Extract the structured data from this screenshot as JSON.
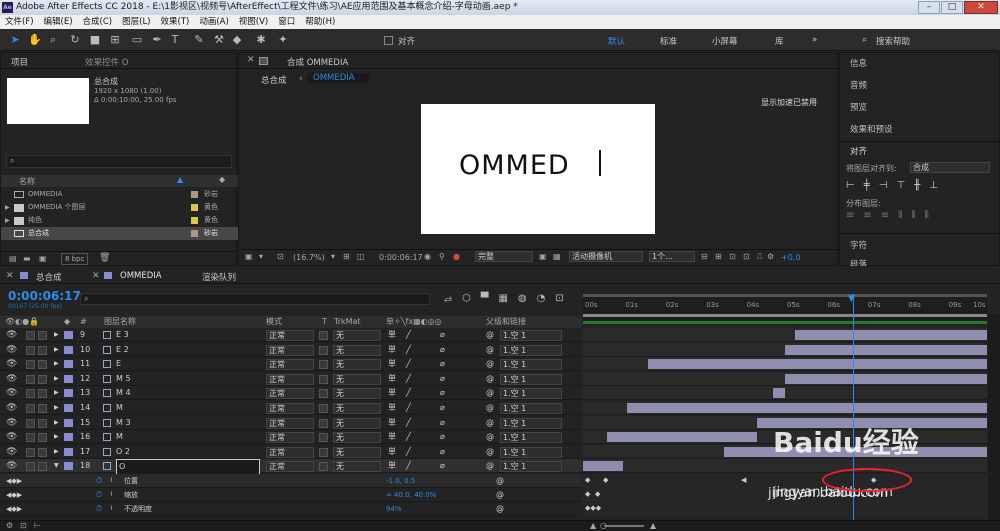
{
  "title": "Adobe After Effects CC 2018 - E:\\1影视区\\视频号\\AfterEffect\\工程文件\\练习\\AE应用范围及基本概念介绍-字母动画.aep *",
  "colors": {
    "accent": "#2d8ceb",
    "layer_bar": "#8f8eae",
    "playhead": "#2d8ceb",
    "canvas": "#ffffff",
    "label_swatch": "#8b8bd0"
  },
  "menu": [
    "文件(F)",
    "编辑(E)",
    "合成(C)",
    "图层(L)",
    "效果(T)",
    "动画(A)",
    "视图(V)",
    "窗口",
    "帮助(H)"
  ],
  "toolbar": {
    "align_label": "对齐",
    "workspaces": [
      "默认",
      "标准",
      "小屏幕",
      "库"
    ],
    "search_placeholder": "搜索帮助",
    "tool_icons": [
      "selection-icon",
      "hand-icon",
      "zoom-icon",
      "rotate-icon",
      "camera-icon",
      "pan-behind-icon",
      "rect-icon",
      "pen-icon",
      "type-icon",
      "brush-icon",
      "clone-icon",
      "eraser-icon",
      "roto-icon",
      "puppet-icon"
    ]
  },
  "project": {
    "tab_label": "项目",
    "effects_tab": "效果控件 O",
    "comp_name": "总合成",
    "comp_res": "1920 x 1080 (1.00)",
    "comp_dur": "Δ 0:00:10:00, 25.00 fps",
    "col_name": "名称",
    "items": [
      {
        "name": "OMMEDIA",
        "color_name": "砂岩",
        "type": "comp"
      },
      {
        "name": "OMMEDIA 个图层",
        "color_name": "黄色",
        "type": "folder"
      },
      {
        "name": "纯色",
        "color_name": "黄色",
        "type": "folder"
      },
      {
        "name": "总合成",
        "color_name": "砂岩",
        "type": "comp"
      }
    ],
    "bpc": "8 bpc"
  },
  "viewer": {
    "tab_label": "合成 OMMEDIA",
    "breadcrumb": [
      "总合成",
      "OMMEDIA"
    ],
    "accel_msg": "显示加速已禁用",
    "canvas_text": "OMMED",
    "zoom": "(16.7%)",
    "timecode": "0:00:06:17",
    "quality": "完整",
    "camera": "活动摄像机",
    "views": "1个...",
    "exposure": "+0.0"
  },
  "right_panel": {
    "items": [
      "信息",
      "音频",
      "预览",
      "效果和预设"
    ],
    "align_title": "对齐",
    "align_to_label": "将图层对齐到:",
    "align_to_value": "合成",
    "distribute_label": "分布图层:",
    "bottom_items": [
      "字符",
      "段落"
    ]
  },
  "timeline": {
    "tabs": [
      "总合成",
      "OMMEDIA",
      "渲染队列"
    ],
    "timecode": "0:00:06:17",
    "frame_info": "00167 (25.00 fps)",
    "search_placeholder": "",
    "headers": {
      "name": "图层名称",
      "mode": "模式",
      "t": "T",
      "trkmat": "TrkMat",
      "parent": "父级和链接"
    },
    "ruler": [
      "00s",
      "01s",
      "02s",
      "03s",
      "04s",
      "05s",
      "06s",
      "07s",
      "08s",
      "09s",
      "10s"
    ],
    "playhead_seconds": 6.68,
    "layers": [
      {
        "num": "9",
        "name": "E 3",
        "mode": "正常",
        "trkmat": "无",
        "parent": "1.空 1",
        "start": 5.25,
        "end": 10
      },
      {
        "num": "10",
        "name": "E 2",
        "mode": "正常",
        "trkmat": "无",
        "parent": "1.空 1",
        "start": 5.0,
        "end": 10
      },
      {
        "num": "11",
        "name": "E",
        "mode": "正常",
        "trkmat": "无",
        "parent": "1.空 1",
        "start": 1.6,
        "end": 10
      },
      {
        "num": "12",
        "name": "M 5",
        "mode": "正常",
        "trkmat": "无",
        "parent": "1.空 1",
        "start": 5.0,
        "end": 10
      },
      {
        "num": "13",
        "name": "M 4",
        "mode": "正常",
        "trkmat": "无",
        "parent": "1.空 1",
        "start": 4.7,
        "end": 5.0
      },
      {
        "num": "14",
        "name": "M",
        "mode": "正常",
        "trkmat": "无",
        "parent": "1.空 1",
        "start": 1.1,
        "end": 10
      },
      {
        "num": "15",
        "name": "M 3",
        "mode": "正常",
        "trkmat": "无",
        "parent": "1.空 1",
        "start": 4.3,
        "end": 10
      },
      {
        "num": "16",
        "name": "M",
        "mode": "正常",
        "trkmat": "无",
        "parent": "1.空 1",
        "start": 0.6,
        "end": 4.3
      },
      {
        "num": "17",
        "name": "O 2",
        "mode": "正常",
        "trkmat": "无",
        "parent": "1.空 1",
        "start": 3.5,
        "end": 10
      },
      {
        "num": "18",
        "name": "O",
        "mode": "正常",
        "trkmat": "无",
        "parent": "1.空 1",
        "start": 0,
        "end": 1.0
      }
    ],
    "props": [
      {
        "name": "位置",
        "value": "-1.0, 0.5"
      },
      {
        "name": "缩放",
        "value": "∞ 40.0, 40.0%"
      },
      {
        "name": "不透明度",
        "value": "94%"
      }
    ]
  },
  "watermark": {
    "logo": "Baidu经验",
    "url": "jingyan.baidu.com"
  }
}
